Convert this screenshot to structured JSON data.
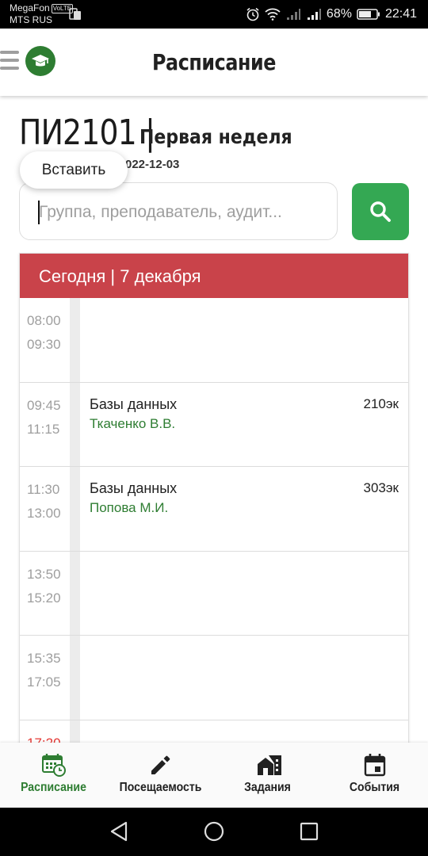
{
  "status_bar": {
    "carrier1": "MegaFon",
    "volte": "VoLTE",
    "carrier2": "MTS RUS",
    "battery": "68%",
    "time": "22:41"
  },
  "app_bar": {
    "title": "Расписание",
    "menu_icon": "hamburger-menu-icon",
    "logo_icon": "graduation-cap-icon"
  },
  "header": {
    "group": "ПИ2101 |",
    "week": "Первая неделя",
    "date_suffix": "022-12-03"
  },
  "context_menu": {
    "paste_label": "Вставить"
  },
  "search": {
    "placeholder": "Группа, преподаватель, аудит...",
    "button_icon": "search-icon"
  },
  "schedule": {
    "day_title": "Сегодня | 7 декабря",
    "header_color": "#c9434a",
    "teacher_color": "#2e7d32",
    "slots": [
      {
        "start": "08:00",
        "end": "09:30",
        "subject": "",
        "teacher": "",
        "room": ""
      },
      {
        "start": "09:45",
        "end": "11:15",
        "subject": "Базы данных",
        "teacher": "Ткаченко В.В.",
        "room": "210эк"
      },
      {
        "start": "11:30",
        "end": "13:00",
        "subject": "Базы данных",
        "teacher": "Попова М.И.",
        "room": "303эк"
      },
      {
        "start": "13:50",
        "end": "15:20",
        "subject": "",
        "teacher": "",
        "room": ""
      },
      {
        "start": "15:35",
        "end": "17:05",
        "subject": "",
        "teacher": "",
        "room": ""
      },
      {
        "start": "17:20",
        "end": "",
        "subject": "",
        "teacher": "",
        "room": ""
      }
    ]
  },
  "bottom_nav": {
    "active_color": "#2e7d32",
    "items": [
      {
        "label": "Расписание",
        "icon": "calendar-clock-icon",
        "active": true
      },
      {
        "label": "Посещаемость",
        "icon": "pencil-icon",
        "active": false
      },
      {
        "label": "Задания",
        "icon": "buildings-icon",
        "active": false
      },
      {
        "label": "События",
        "icon": "calendar-icon",
        "active": false
      }
    ]
  },
  "system_nav": {
    "back_icon": "back-triangle-icon",
    "home_icon": "home-circle-icon",
    "recents_icon": "recents-square-icon"
  }
}
